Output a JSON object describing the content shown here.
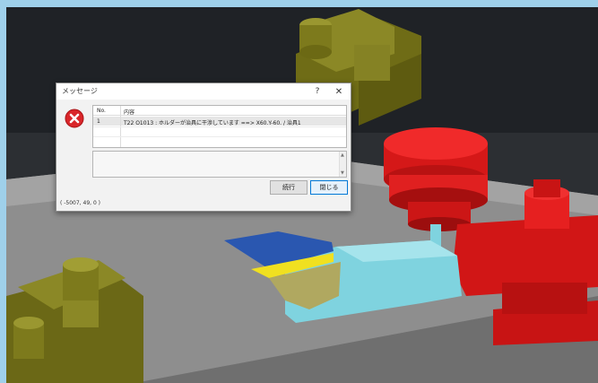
{
  "dialog": {
    "title": "メッセージ",
    "help_label": "?",
    "close_label": "✕",
    "icon": "error-icon",
    "columns": {
      "no": "No.",
      "content": "内容"
    },
    "rows": [
      {
        "no": "1",
        "content": "T22 O1013 : ホルダーが治具に干渉しています ==> X60.Y-60. / 治具1"
      }
    ],
    "buttons": {
      "continue": "続行",
      "close": "閉じる"
    },
    "coordinates": "( -5007, 49, 0 )"
  },
  "colors": {
    "background_sky": "#9fd0ea",
    "table_gray": "#8c8c8c",
    "fixture_olive": "#7d7a1c",
    "tool_red": "#e62020",
    "workpiece_cyan": "#7fd3df",
    "part_blue": "#2a57b0",
    "part_yellow": "#f0e020",
    "error_red": "#d9262a"
  }
}
